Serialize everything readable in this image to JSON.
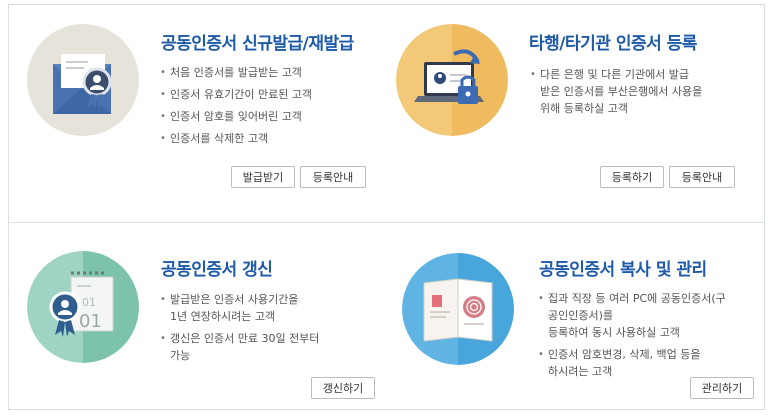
{
  "panels": {
    "issue": {
      "title": "공동인증서 신규발급/재발급",
      "bullets": [
        "처음 인증서를 발급받는 고객",
        "인증서 유효기간이 만료된 고객",
        "인증서 암호를 잊어버린 고객",
        "인증서를 삭제한 고객"
      ],
      "buttons": [
        "발급받기",
        "등록안내"
      ]
    },
    "register": {
      "title": "타행/타기관 인증서 등록",
      "bullets": [
        "다른 은행 및 다른 기관에서 발급\n받은 인증서를 부산은행에서 사용을\n위해 등록하실 고객"
      ],
      "buttons": [
        "등록하기",
        "등록안내"
      ]
    },
    "renew": {
      "title": "공동인증서 갱신",
      "bullets": [
        "발급받은 인증서 사용기간을\n1년 연장하시려는 고객",
        "갱신은 인증서 만료 30일 전부터\n가능"
      ],
      "buttons": [
        "갱신하기"
      ]
    },
    "manage": {
      "title": "공동인증서 복사 및 관리",
      "bullets": [
        "집과 직장 등 여러 PC에 공동인증서(구\n공인인증서)를\n등록하여 동시 사용하실 고객",
        "인증서 암호변경, 삭제, 백업 등을\n하시려는 고객"
      ],
      "buttons": [
        "관리하기"
      ]
    }
  },
  "calendar": {
    "month": "01",
    "day": "01"
  }
}
